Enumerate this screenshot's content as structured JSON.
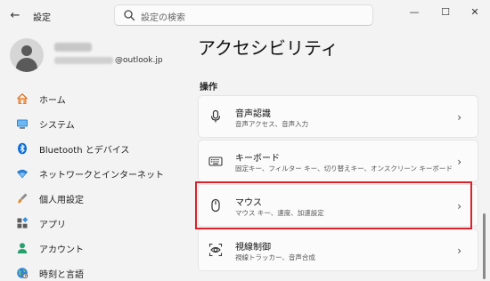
{
  "window": {
    "title": "設定",
    "back_glyph": "←",
    "minimize_glyph": "—",
    "maximize_glyph": "☐",
    "close_glyph": "✕"
  },
  "search": {
    "placeholder": "設定の検索"
  },
  "profile": {
    "email_domain": "@outlook.jp"
  },
  "sidebar": {
    "items": [
      {
        "label": "ホーム",
        "icon": "home-icon"
      },
      {
        "label": "システム",
        "icon": "monitor-icon"
      },
      {
        "label": "Bluetooth とデバイス",
        "icon": "bluetooth-icon"
      },
      {
        "label": "ネットワークとインターネット",
        "icon": "wifi-icon"
      },
      {
        "label": "個人用設定",
        "icon": "brush-icon"
      },
      {
        "label": "アプリ",
        "icon": "apps-icon"
      },
      {
        "label": "アカウント",
        "icon": "person-icon"
      },
      {
        "label": "時刻と言語",
        "icon": "globe-icon"
      }
    ]
  },
  "main": {
    "title": "アクセシビリティ",
    "section": "操作",
    "cards": [
      {
        "title": "音声認識",
        "desc": "音声アクセス、音声入力",
        "icon": "microphone-icon"
      },
      {
        "title": "キーボード",
        "desc": "固定キー、フィルター キー、切り替えキー、オンスクリーン キーボード",
        "icon": "keyboard-icon"
      },
      {
        "title": "マウス",
        "desc": "マウス キー、速度、加速設定",
        "icon": "mouse-icon"
      },
      {
        "title": "視線制御",
        "desc": "視線トラッカー、音声合成",
        "icon": "eye-control-icon"
      }
    ],
    "chevron": "›"
  },
  "colors": {
    "highlight": "#d9222b",
    "accent_blue": "#0067c0"
  }
}
